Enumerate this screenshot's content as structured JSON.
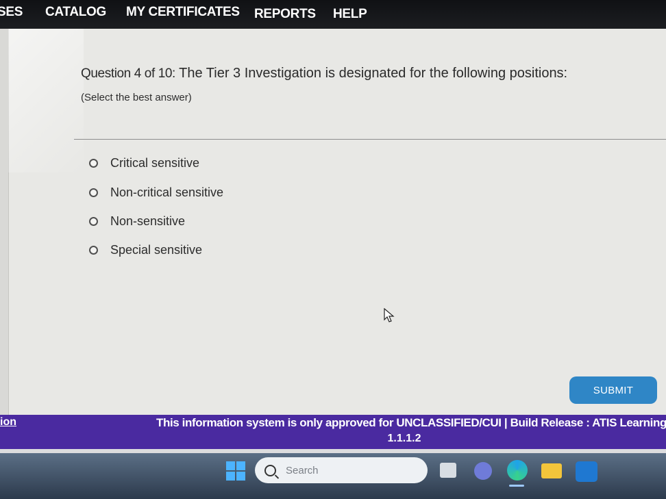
{
  "nav": {
    "items": [
      "SES",
      "CATALOG",
      "MY CERTIFICATES",
      "REPORTS",
      "HELP"
    ]
  },
  "question": {
    "number_label": "Question 4 of 10:",
    "text": "The Tier 3 Investigation is designated for the following positions:",
    "hint": "(Select the best answer)",
    "options": [
      "Critical sensitive",
      "Non-critical sensitive",
      "Non-sensitive",
      "Special sensitive"
    ],
    "selected_index": null
  },
  "actions": {
    "submit_label": "SUBMIT"
  },
  "footer": {
    "left_link": "ion",
    "notice_line1": "This information system is only approved for UNCLASSIFIED/CUI | Build Release : ATIS Learning",
    "notice_line2": "1.1.1.2"
  },
  "taskbar": {
    "search_placeholder": "Search",
    "icons": [
      "windows-start-icon",
      "search-icon",
      "task-view-icon",
      "teams-icon",
      "edge-browser-icon",
      "file-explorer-icon",
      "outlook-icon"
    ]
  },
  "colors": {
    "nav_bg": "#16181b",
    "content_bg": "#e8e8e5",
    "submit_bg": "#2f86c6",
    "footer_bg": "#4a2aa0"
  }
}
